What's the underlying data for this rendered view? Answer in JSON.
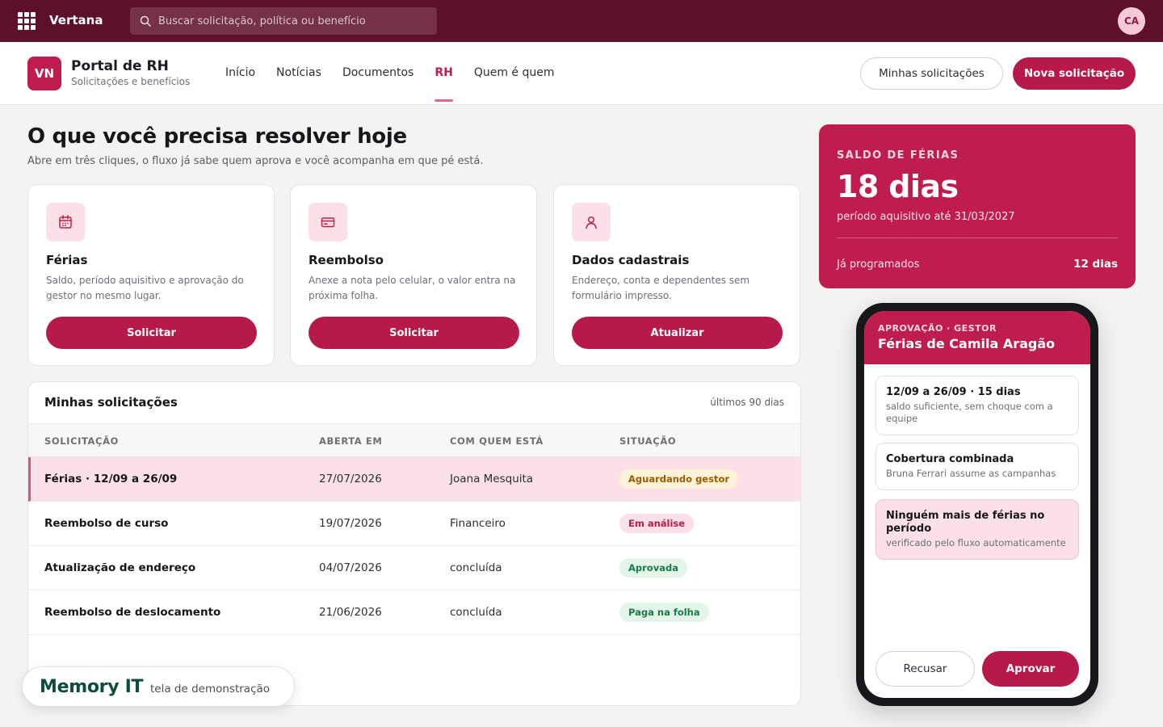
{
  "topbar": {
    "brand": "Vertana",
    "search_placeholder": "Buscar solicitação, política ou benefício",
    "avatar_initials": "CA",
    "bg_color": "#5e102b"
  },
  "header": {
    "logo": "VN",
    "title": "Portal de RH",
    "subtitle": "Solicitações e benefícios",
    "nav": [
      "Início",
      "Notícias",
      "Documentos",
      "RH",
      "Quem é quem"
    ],
    "active_nav": "RH",
    "my_requests_label": "Minhas solicitações",
    "new_request_label": "Nova solicitação",
    "accent_color": "#b71a4a"
  },
  "main": {
    "title": "O que você precisa resolver hoje",
    "subtitle": "Abre em três cliques, o fluxo já sabe quem aprova e você acompanha em que pé está."
  },
  "cards": [
    {
      "icon": "calendar-icon",
      "title": "Férias",
      "description": "Saldo, período aquisitivo e aprovação do gestor no mesmo lugar.",
      "button": "Solicitar"
    },
    {
      "icon": "credit-card-icon",
      "title": "Reembolso",
      "description": "Anexe a nota pelo celular, o valor entra na próxima folha.",
      "button": "Solicitar"
    },
    {
      "icon": "user-icon",
      "title": "Dados cadastrais",
      "description": "Endereço, conta e dependentes sem formulário impresso.",
      "button": "Atualizar"
    }
  ],
  "requests": {
    "title": "Minhas solicitações",
    "range": "últimos 90 dias",
    "columns": [
      "SOLICITAÇÃO",
      "ABERTA EM",
      "COM QUEM ESTÁ",
      "SITUAÇÃO"
    ],
    "rows": [
      {
        "name": "Férias · 12/09 a 26/09",
        "opened": "27/07/2026",
        "with": "Joana Mesquita",
        "status": "Aguardando gestor",
        "status_bg": "#fdf1d8",
        "status_color": "#9a5b00",
        "highlight": true
      },
      {
        "name": "Reembolso de curso",
        "opened": "19/07/2026",
        "with": "Financeiro",
        "status": "Em análise",
        "status_bg": "#fbe0e8",
        "status_color": "#b71a4a",
        "highlight": false
      },
      {
        "name": "Atualização de endereço",
        "opened": "04/07/2026",
        "with": "concluída",
        "status": "Aprovada",
        "status_bg": "#e3f4e9",
        "status_color": "#1a7a46",
        "highlight": false
      },
      {
        "name": "Reembolso de deslocamento",
        "opened": "21/06/2026",
        "with": "concluída",
        "status": "Paga na folha",
        "status_bg": "#e3f4e9",
        "status_color": "#1a7a46",
        "highlight": false
      }
    ]
  },
  "balance": {
    "label": "SALDO DE FÉRIAS",
    "value": "18 dias",
    "period": "período aquisitivo até 31/03/2027",
    "scheduled_label": "Já programados",
    "scheduled_value": "12 dias"
  },
  "phone": {
    "label": "APROVAÇÃO · GESTOR",
    "title": "Férias de Camila Aragão",
    "items": [
      {
        "title": "12/09 a 26/09 · 15 dias",
        "subtitle": "saldo suficiente, sem choque com a equipe"
      },
      {
        "title": "Cobertura combinada",
        "subtitle": "Bruna Ferrari assume as campanhas"
      },
      {
        "title": "Ninguém mais de férias no período",
        "subtitle": "verificado pelo fluxo automaticamente"
      }
    ],
    "reject_label": "Recusar",
    "approve_label": "Aprovar"
  },
  "watermark": {
    "brand": "Memory IT",
    "subtitle": "tela de demonstração"
  }
}
